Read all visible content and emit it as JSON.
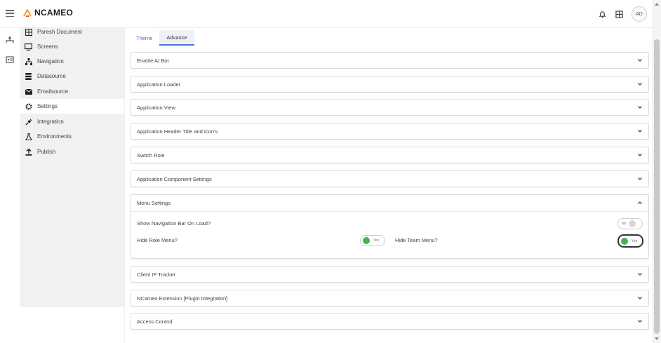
{
  "app": {
    "logo_text": "NCAMEO",
    "brand_color": "#f4a126",
    "accent_color": "#4a78d6",
    "toggle_on_color": "#4caf50"
  },
  "header": {
    "avatar_initials": "AD",
    "icons": [
      "menu-icon",
      "bell-icon",
      "grid-icon"
    ]
  },
  "rail": {
    "icons": [
      "workflow-icon",
      "id-card-icon"
    ]
  },
  "sidebar": {
    "items": [
      {
        "label": "Paresh Document",
        "icon": "grid-icon"
      },
      {
        "label": "Screens",
        "icon": "monitor-icon"
      },
      {
        "label": "Navigation",
        "icon": "sitemap-icon"
      },
      {
        "label": "Datasource",
        "icon": "database-icon"
      },
      {
        "label": "Emailsource",
        "icon": "envelope-icon"
      },
      {
        "label": "Settings",
        "icon": "gear-icon",
        "active": true
      },
      {
        "label": "Integration",
        "icon": "plug-icon"
      },
      {
        "label": "Environments",
        "icon": "flask-icon"
      },
      {
        "label": "Publish",
        "icon": "upload-icon"
      }
    ]
  },
  "tabs": [
    {
      "label": "Theme",
      "selected": false
    },
    {
      "label": "Advance",
      "selected": true
    }
  ],
  "panels": [
    {
      "title": "Enable AI Bot",
      "expanded": false
    },
    {
      "title": "Application Loader",
      "expanded": false
    },
    {
      "title": "Application View",
      "expanded": false
    },
    {
      "title": "Application Header Title and Icon's",
      "expanded": false
    },
    {
      "title": "Switch Role",
      "expanded": false
    },
    {
      "title": "Application Component Settings",
      "expanded": false
    },
    {
      "title": "Menu Settings",
      "expanded": true
    },
    {
      "title": "Client IP Tracker",
      "expanded": false
    },
    {
      "title": "NCameo Extension [Plugin Integration]",
      "expanded": false
    },
    {
      "title": "Access Control",
      "expanded": false
    }
  ],
  "menu_settings": {
    "show_nav_label": "Show Navigation Bar On Load?",
    "show_nav_toggle": "No",
    "hide_role_label": "Hide Role Menu?",
    "hide_role_toggle": "Yes",
    "hide_team_label": "Hide Team Menu?",
    "hide_team_toggle": "Yes"
  }
}
